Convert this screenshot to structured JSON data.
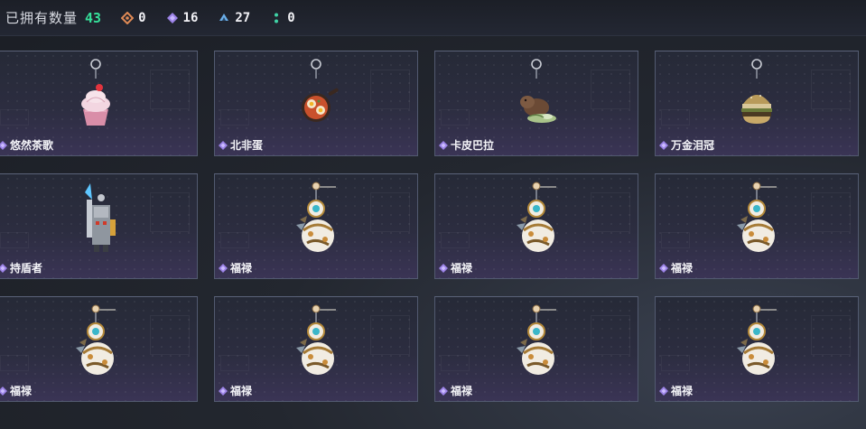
{
  "header": {
    "owned_label": "已拥有数量",
    "owned_count": "43",
    "stats": [
      {
        "icon": "orange-diamond-icon",
        "color": "#e08a55",
        "value": "0"
      },
      {
        "icon": "purple-diamond-icon",
        "color": "#9b82e6",
        "value": "16"
      },
      {
        "icon": "blue-triangle-icon",
        "color": "#6aaee8",
        "value": "27"
      },
      {
        "icon": "green-dots-icon",
        "color": "#3fd3a6",
        "value": "0"
      }
    ]
  },
  "items": [
    {
      "name": "悠然茶歌",
      "icon": "cupcake-charm-icon"
    },
    {
      "name": "北非蛋",
      "icon": "shakshuka-pan-charm-icon"
    },
    {
      "name": "卡皮巴拉",
      "icon": "capybara-charm-icon"
    },
    {
      "name": "万金泪冠",
      "icon": "burger-charm-icon"
    },
    {
      "name": "持盾者",
      "icon": "shield-robot-charm-icon"
    },
    {
      "name": "福禄",
      "icon": "gourd-charm-icon"
    },
    {
      "name": "福禄",
      "icon": "gourd-charm-icon"
    },
    {
      "name": "福禄",
      "icon": "gourd-charm-icon"
    },
    {
      "name": "福禄",
      "icon": "gourd-charm-icon"
    },
    {
      "name": "福禄",
      "icon": "gourd-charm-icon"
    },
    {
      "name": "福禄",
      "icon": "gourd-charm-icon"
    },
    {
      "name": "福禄",
      "icon": "gourd-charm-icon"
    }
  ],
  "colors": {
    "accent_green": "#36e09a",
    "rarity_purple": "#9b82e6"
  }
}
